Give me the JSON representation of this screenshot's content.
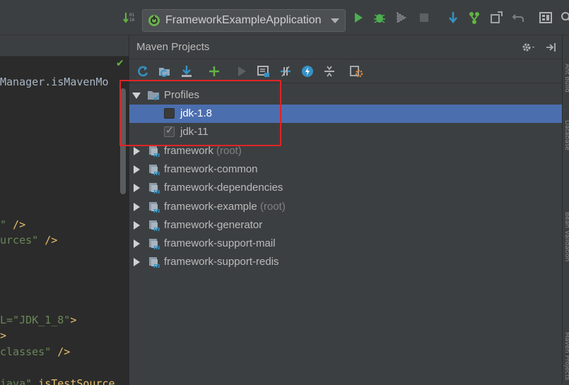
{
  "run_config": {
    "label": "FrameworkExampleApplication"
  },
  "maven_panel": {
    "title": "Maven Projects",
    "settings_icon": "gear-icon",
    "tree": {
      "profiles": {
        "label": "Profiles",
        "items": [
          {
            "label": "jdk-1.8",
            "checked": false,
            "selected": true
          },
          {
            "label": "jdk-11",
            "checked": true,
            "selected": false
          }
        ]
      },
      "projects": [
        {
          "label": "framework",
          "suffix": "(root)"
        },
        {
          "label": "framework-common",
          "suffix": ""
        },
        {
          "label": "framework-dependencies",
          "suffix": ""
        },
        {
          "label": "framework-example",
          "suffix": "(root)"
        },
        {
          "label": "framework-generator",
          "suffix": ""
        },
        {
          "label": "framework-support-mail",
          "suffix": ""
        },
        {
          "label": "framework-support-redis",
          "suffix": ""
        }
      ]
    }
  },
  "editor": {
    "lines": [
      {
        "plain": "Manager.isMavenMo",
        "str": "",
        "tag": ""
      },
      {
        "plain": "",
        "str": "\"",
        "tag": " />"
      },
      {
        "plain": "",
        "str": "urces\"",
        "tag": " />"
      },
      {
        "plain": "",
        "str": "L=\"JDK_1_8\"",
        "tag": ">"
      },
      {
        "plain": "",
        "str": "",
        "tag": ">"
      },
      {
        "plain": "",
        "str": "classes\"",
        "tag": " />"
      },
      {
        "plain": "",
        "str": "iava\"",
        "tag": " isTestSource"
      }
    ]
  },
  "colors": {
    "accent_selection": "#4b6eaf",
    "highlight_box": "#e02424",
    "run_green": "#4caf50"
  }
}
